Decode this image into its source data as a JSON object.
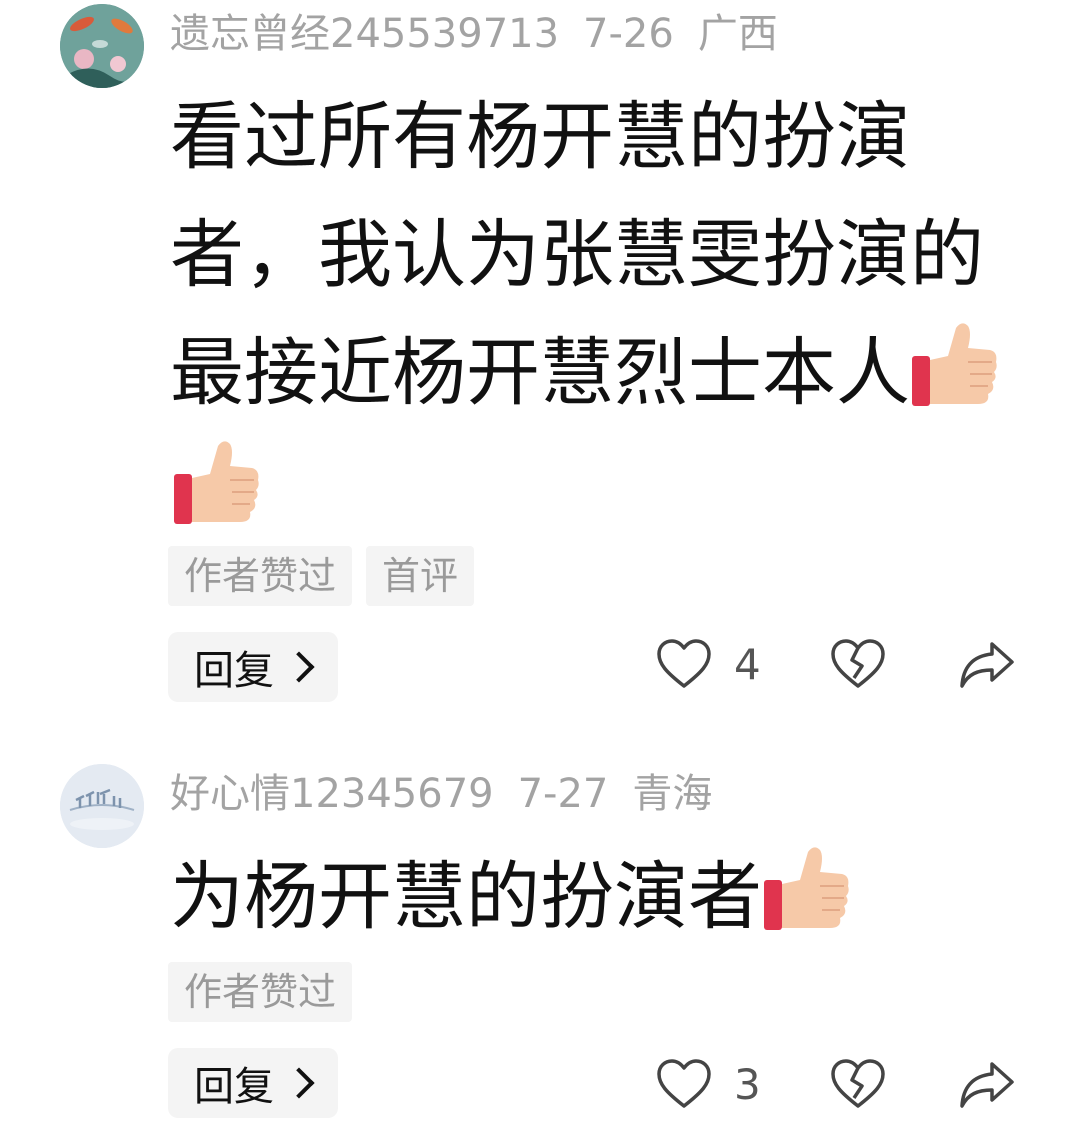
{
  "comments": [
    {
      "username": "遗忘曾经245539713",
      "date": "7-26",
      "location": "广西",
      "text": "看过所有杨开慧的扮演者，我认为张慧雯扮演的最接近杨开慧烈士本人",
      "emoji": [
        "thumbs-up",
        "thumbs-up"
      ],
      "tags": [
        "作者赞过",
        "首评"
      ],
      "reply_label": "回复",
      "like_count": "4",
      "avatar_icon": "koi-lotus-avatar-icon"
    },
    {
      "username": "好心情12345679",
      "date": "7-27",
      "location": "青海",
      "text": "为杨开慧的扮演者",
      "emoji": [
        "thumbs-up"
      ],
      "tags": [
        "作者赞过"
      ],
      "reply_label": "回复",
      "like_count": "3",
      "avatar_icon": "snowy-tree-avatar-icon"
    }
  ],
  "colors": {
    "meta_text": "#a3a3a3",
    "tag_bg": "#f4f4f4",
    "tag_text": "#9a9a9a",
    "icon_stroke": "#444444",
    "thumb_skin": "#f6c9a8",
    "thumb_cuff": "#e0344e"
  },
  "icons": {
    "like": "heart-outline-icon",
    "dislike": "broken-heart-icon",
    "share": "share-arrow-icon",
    "reply_chevron": "chevron-right-icon"
  }
}
